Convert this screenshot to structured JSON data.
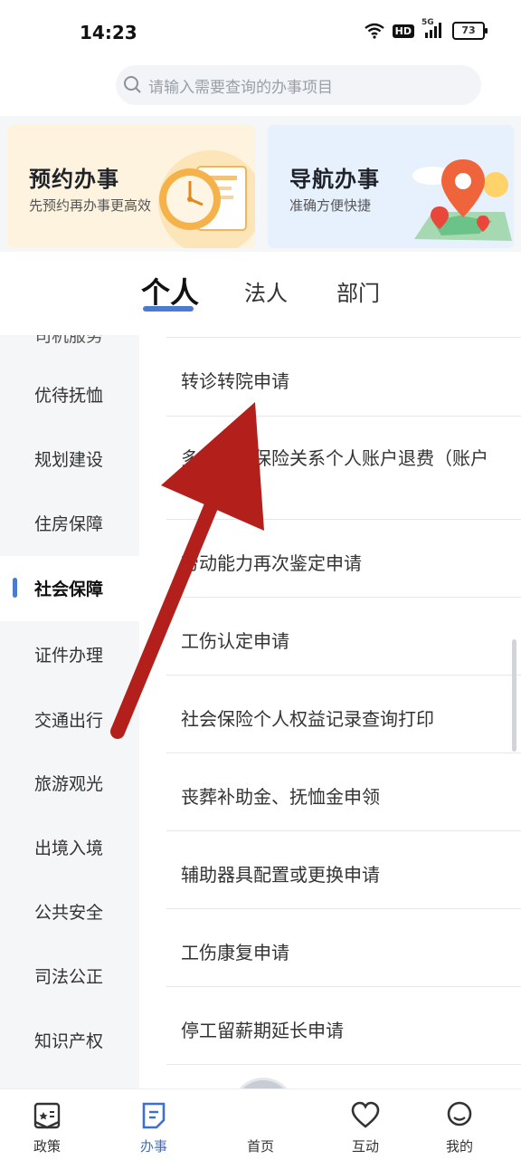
{
  "status_bar": {
    "time": "14:23",
    "hd": "HD",
    "signal": "5G",
    "battery": "73"
  },
  "search": {
    "placeholder": "请输入需要查询的办事项目"
  },
  "banners": [
    {
      "title": "预约办事",
      "subtitle": "先预约再办事更高效"
    },
    {
      "title": "导航办事",
      "subtitle": "准确方便快捷"
    }
  ],
  "tabs": [
    {
      "label": "个人",
      "active": true
    },
    {
      "label": "法人",
      "active": false
    },
    {
      "label": "部门",
      "active": false
    }
  ],
  "sidebar": {
    "items": [
      {
        "label": "司机服务"
      },
      {
        "label": "优待抚恤"
      },
      {
        "label": "规划建设"
      },
      {
        "label": "住房保障"
      },
      {
        "label": "社会保障",
        "active": true
      },
      {
        "label": "证件办理"
      },
      {
        "label": "交通出行"
      },
      {
        "label": "旅游观光"
      },
      {
        "label": "出境入境"
      },
      {
        "label": "公共安全"
      },
      {
        "label": "司法公正"
      },
      {
        "label": "知识产权"
      }
    ]
  },
  "list": {
    "items": [
      {
        "label": "转诊转院申请"
      },
      {
        "label": "多地养老保险关系个人账户退费（账户合并）"
      },
      {
        "label": "劳动能力再次鉴定申请"
      },
      {
        "label": "工伤认定申请"
      },
      {
        "label": "社会保险个人权益记录查询打印"
      },
      {
        "label": "丧葬补助金、抚恤金申领"
      },
      {
        "label": "辅助器具配置或更换申请"
      },
      {
        "label": "工伤康复申请"
      },
      {
        "label": "停工留薪期延长申请"
      }
    ]
  },
  "tabbar": {
    "items": [
      {
        "label": "政策",
        "icon": "policy-icon"
      },
      {
        "label": "办事",
        "icon": "service-icon",
        "active": true
      },
      {
        "label": "首页",
        "icon": "home-emblem-icon"
      },
      {
        "label": "互动",
        "icon": "heart-icon"
      },
      {
        "label": "我的",
        "icon": "user-icon"
      }
    ]
  },
  "colors": {
    "accent": "#4a7bd0",
    "arrow": "#b3201c"
  }
}
